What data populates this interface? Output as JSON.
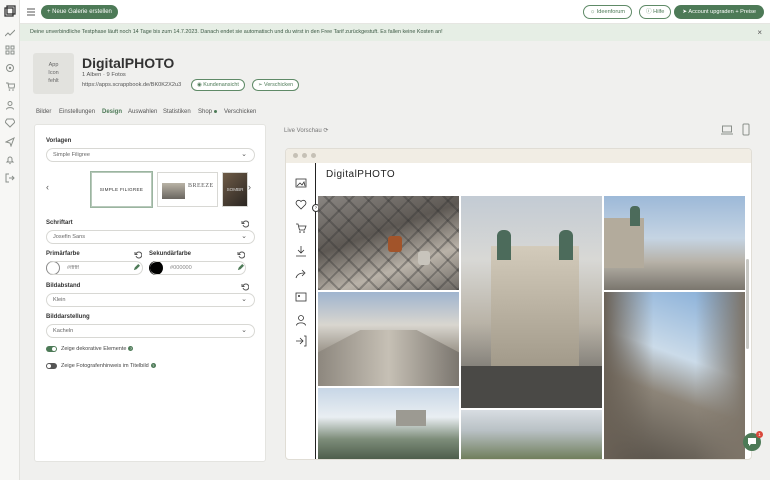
{
  "topbar": {
    "new_gallery": "+ Neue Galerie erstellen",
    "ideas": "Ideenforum",
    "help": "Hilfe",
    "upgrade": "Account upgraden + Preise"
  },
  "banner": {
    "text": "Deine unverbindliche Testphase läuft noch 14 Tage bis zum 14.7.2023. Danach endet sie automatisch und du wirst in den Free Tarif zurückgestuft. Es fallen keine Kosten an!",
    "close": "×"
  },
  "header": {
    "app_icon_line1": "App",
    "app_icon_line2": "Icon",
    "app_icon_line3": "fehlt",
    "title": "DigitalPHOTO",
    "meta": "1 Alben · 9 Fotos",
    "url": "https://apps.scrappbook.de/BK0K2X2u3",
    "btn_customer_view": "Kundenansicht",
    "btn_send": "Verschicken"
  },
  "tabs": [
    "Bilder",
    "Einstellungen",
    "Design",
    "Auswahlen",
    "Statistiken",
    "Shop",
    "Verschicken"
  ],
  "design": {
    "templates_label": "Vorlagen",
    "template_value": "Simple Filigree",
    "templates": [
      "SIMPLE FILIGREE",
      "BREEZE",
      "SOMBR"
    ],
    "font_label": "Schriftart",
    "font_value": "Josefin Sans",
    "primary_label": "Primärfarbe",
    "primary_value": "#ffffff",
    "secondary_label": "Sekundärfarbe",
    "secondary_value": "#000000",
    "spacing_label": "Bildabstand",
    "spacing_value": "Klein",
    "display_label": "Bilddarstellung",
    "display_value": "Kacheln",
    "toggle1": "Zeige dekorative Elemente",
    "toggle2": "Zeige Fotografenhinweis im Titelbild"
  },
  "preview": {
    "label": "Live Vorschau",
    "brand": "DigitalPHOTO"
  },
  "chat_badge": "1",
  "colors": {
    "accent": "#4d7a57",
    "banner": "#e6eee5"
  }
}
